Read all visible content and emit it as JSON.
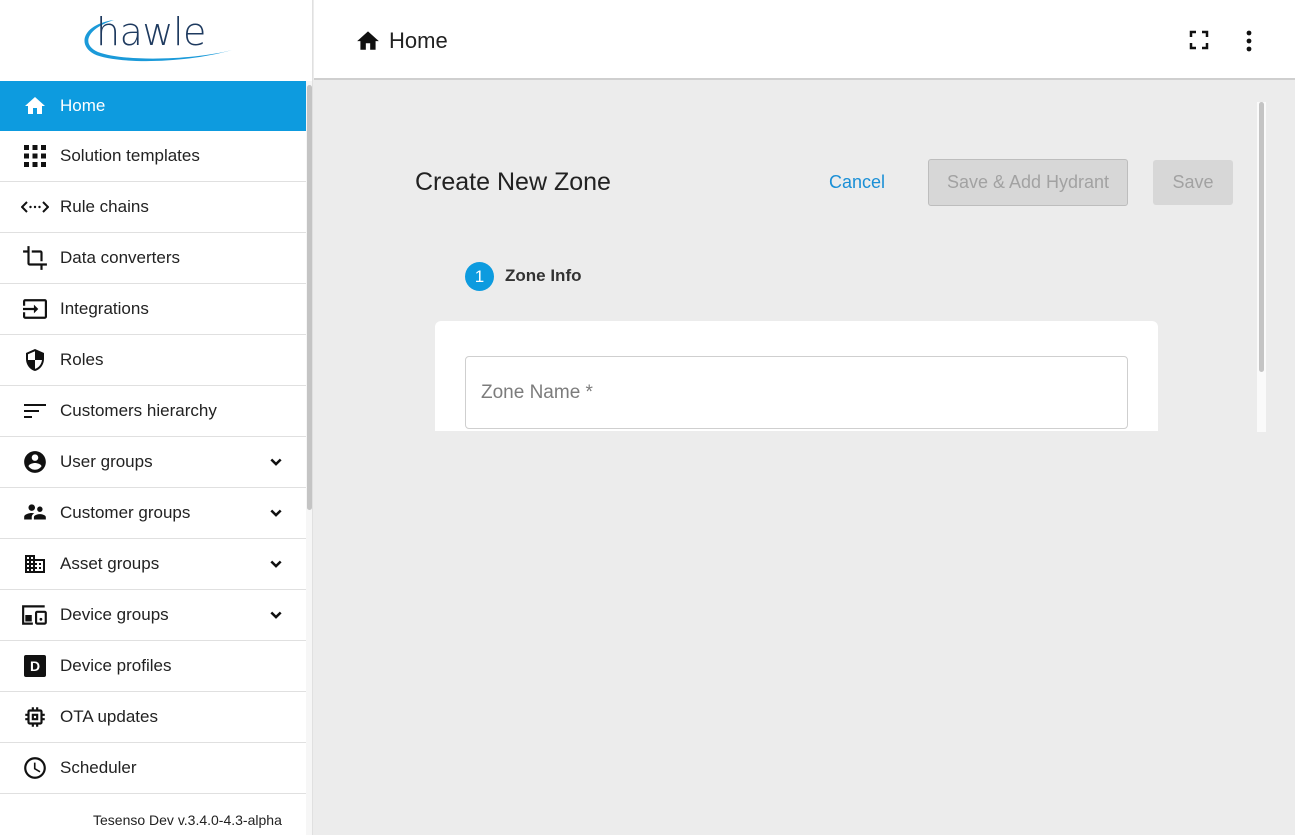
{
  "brand": {
    "logo_text": "hawle"
  },
  "sidebar": {
    "items": [
      {
        "label": "Home",
        "icon": "home-icon",
        "active": true
      },
      {
        "label": "Solution templates",
        "icon": "grid-icon"
      },
      {
        "label": "Rule chains",
        "icon": "code-arrows-icon"
      },
      {
        "label": "Data converters",
        "icon": "crop-icon"
      },
      {
        "label": "Integrations",
        "icon": "input-icon"
      },
      {
        "label": "Roles",
        "icon": "shield-icon"
      },
      {
        "label": "Customers hierarchy",
        "icon": "sort-lines-icon"
      },
      {
        "label": "User groups",
        "icon": "account-circle-icon",
        "expandable": true
      },
      {
        "label": "Customer groups",
        "icon": "supervisor-icon",
        "expandable": true
      },
      {
        "label": "Asset groups",
        "icon": "building-icon",
        "expandable": true
      },
      {
        "label": "Device groups",
        "icon": "devices-icon",
        "expandable": true
      },
      {
        "label": "Device profiles",
        "icon": "device-profile-icon"
      },
      {
        "label": "OTA updates",
        "icon": "chip-icon"
      },
      {
        "label": "Scheduler",
        "icon": "clock-icon"
      }
    ],
    "version": "Tesenso Dev v.3.4.0-4.3-alpha"
  },
  "header": {
    "title": "Home"
  },
  "form": {
    "title": "Create New Zone",
    "cancel_label": "Cancel",
    "save_add_label": "Save & Add Hydrant",
    "save_label": "Save",
    "step": {
      "number": "1",
      "label": "Zone Info"
    },
    "zone_name": {
      "placeholder": "Zone Name *",
      "value": ""
    }
  },
  "colors": {
    "accent": "#0d9bdf",
    "link": "#1a8fd6",
    "disabled_bg": "#d7d7d7",
    "disabled_text": "#a2a2a2"
  }
}
